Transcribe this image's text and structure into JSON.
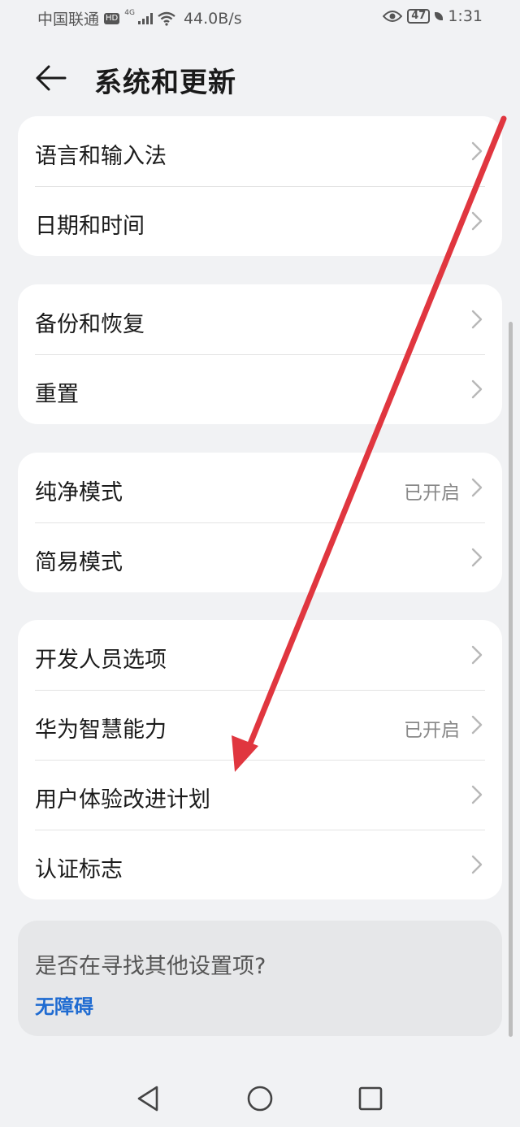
{
  "status_bar": {
    "carrier": "中国联通",
    "hd": "HD",
    "network": "4G",
    "speed": "44.0B/s",
    "battery": "47",
    "time": "1:31"
  },
  "header": {
    "title": "系统和更新",
    "back_icon": "arrow-left-icon"
  },
  "groups": [
    {
      "items": [
        {
          "label": "语言和输入法",
          "value": ""
        },
        {
          "label": "日期和时间",
          "value": ""
        }
      ]
    },
    {
      "items": [
        {
          "label": "备份和恢复",
          "value": ""
        },
        {
          "label": "重置",
          "value": ""
        }
      ]
    },
    {
      "items": [
        {
          "label": "纯净模式",
          "value": "已开启"
        },
        {
          "label": "简易模式",
          "value": ""
        }
      ]
    },
    {
      "items": [
        {
          "label": "开发人员选项",
          "value": ""
        },
        {
          "label": "华为智慧能力",
          "value": "已开启"
        },
        {
          "label": "用户体验改进计划",
          "value": ""
        },
        {
          "label": "认证标志",
          "value": ""
        }
      ]
    }
  ],
  "help": {
    "title": "是否在寻找其他设置项?",
    "link": "无障碍"
  },
  "colors": {
    "background": "#f1f2f4",
    "link": "#1f6bd1",
    "annotation_arrow": "#e0363f"
  }
}
